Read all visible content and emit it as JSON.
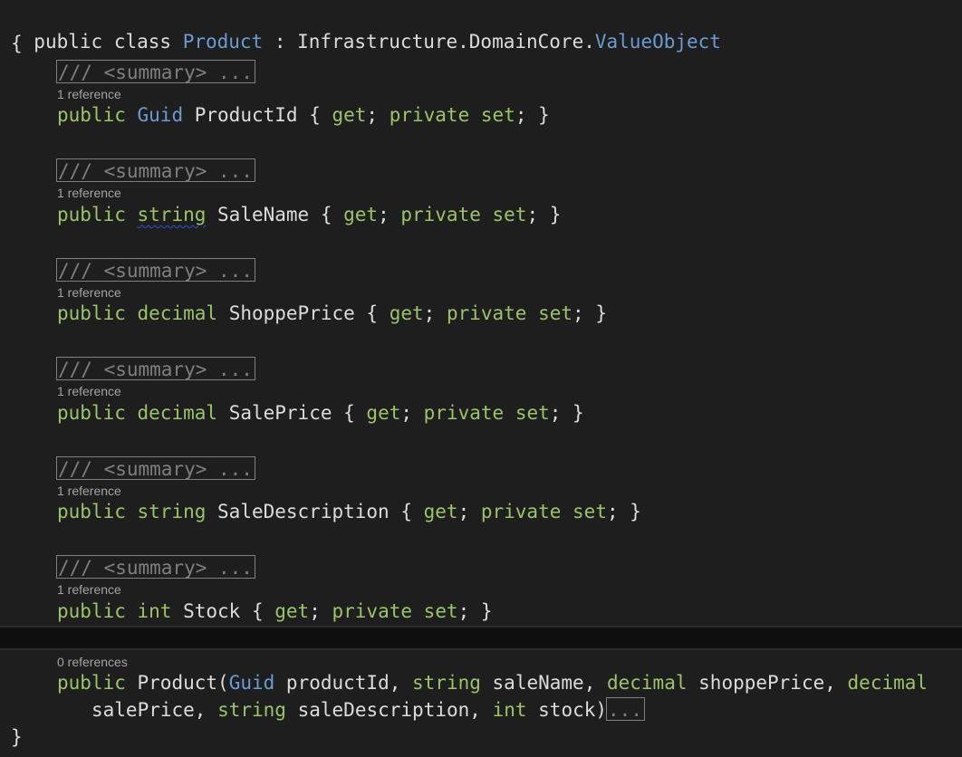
{
  "code": {
    "class_decl": {
      "kw_public": "public",
      "kw_class": "class",
      "class_name": "Product",
      "colon": " : ",
      "base_ns": "Infrastructure.DomainCore.",
      "base_type": "ValueObject"
    },
    "open_brace": "{",
    "close_brace": "}",
    "summary_collapsed": "/// <summary> ...",
    "properties": [
      {
        "reference": "1 reference",
        "type": "Guid",
        "name": "ProductId"
      },
      {
        "reference": "1 reference",
        "type": "string",
        "name": "SaleName"
      },
      {
        "reference": "1 reference",
        "type": "decimal",
        "name": "ShoppePrice"
      },
      {
        "reference": "1 reference",
        "type": "decimal",
        "name": "SalePrice"
      },
      {
        "reference": "1 reference",
        "type": "string",
        "name": "SaleDescription"
      },
      {
        "reference": "1 reference",
        "type": "int",
        "name": "Stock"
      }
    ],
    "accessor": {
      "public": "public",
      "open": " { ",
      "get": "get",
      "semi": "; ",
      "private": "private",
      "set": "set",
      "close": "; }"
    },
    "constructor": {
      "reference": "0 references",
      "kw_public": "public",
      "name": "Product",
      "line1_params": [
        {
          "type": "Guid",
          "name": "productId"
        },
        {
          "type": "string",
          "name": "saleName"
        },
        {
          "type": "decimal",
          "name": "shoppePrice"
        }
      ],
      "line1_trailing_type": "decimal",
      "line2_lead_name": "salePrice",
      "line2_params": [
        {
          "type": "string",
          "name": "saleDescription"
        },
        {
          "type": "int",
          "name": "stock"
        }
      ],
      "collapsed_body": "..."
    }
  }
}
